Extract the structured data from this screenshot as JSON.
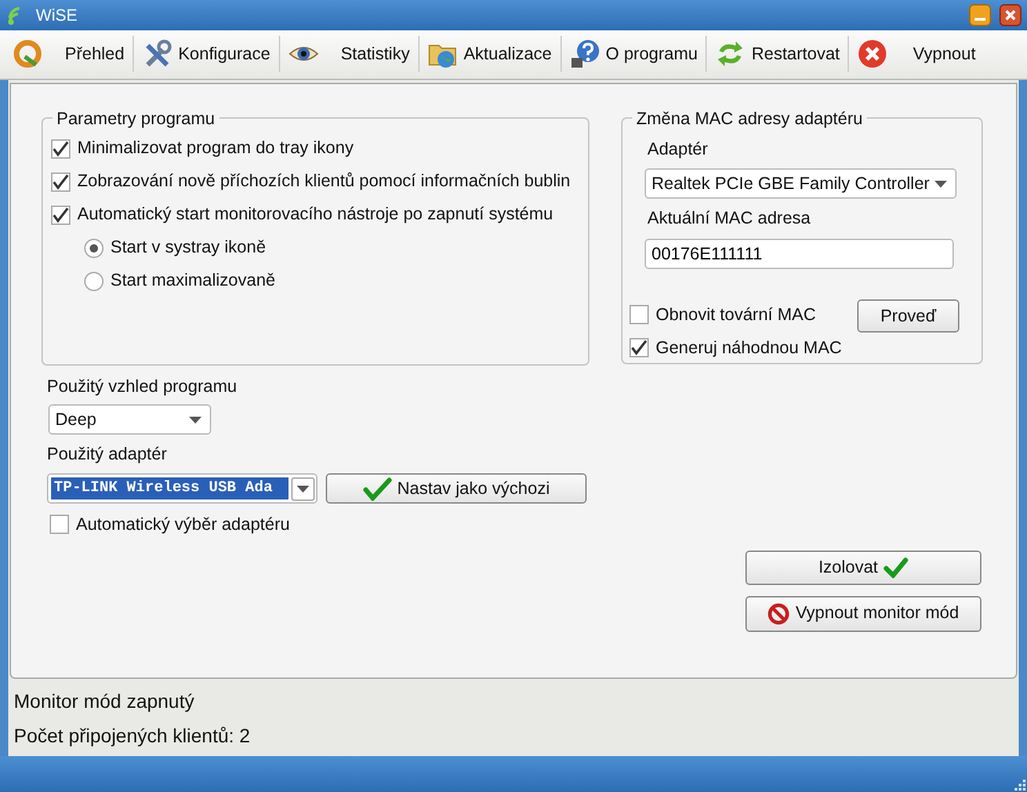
{
  "window": {
    "title": "WiSE"
  },
  "toolbar": [
    {
      "label": "Přehled"
    },
    {
      "label": "Konfigurace"
    },
    {
      "label": "Statistiky"
    },
    {
      "label": "Aktualizace"
    },
    {
      "label": "O programu"
    },
    {
      "label": "Restartovat"
    },
    {
      "label": "Vypnout"
    }
  ],
  "program_settings": {
    "title": "Parametry programu",
    "options": [
      {
        "kind": "checkbox",
        "label": "Minimalizovat program do tray ikony",
        "checked": true
      },
      {
        "kind": "checkbox",
        "label": "Zobrazování nově příchozích klientů pomocí informačních bublin",
        "checked": true
      },
      {
        "kind": "checkbox",
        "label": "Automatický start monitorovacího nástroje po zapnutí systému",
        "checked": true
      },
      {
        "kind": "radio",
        "label": "Start v systray ikoně",
        "selected": true
      },
      {
        "kind": "radio",
        "label": "Start maximalizovaně",
        "selected": false
      }
    ]
  },
  "mac_change": {
    "title": "Změna MAC adresy adaptéru",
    "adapter_label": "Adaptér",
    "adapter_value": "Realtek PCIe GBE Family Controller",
    "mac_label": "Aktuální MAC adresa",
    "mac_value": "00176E111111",
    "options": [
      {
        "label": "Obnovit tovární MAC",
        "checked": false
      },
      {
        "label": "Generuj náhodnou MAC",
        "checked": true
      }
    ],
    "apply_button": "Proveď"
  },
  "appearance": {
    "label": "Použitý vzhled programu",
    "value": "Deep"
  },
  "adapter": {
    "label": "Použitý adaptér",
    "value": "TP-LINK Wireless USB Ada",
    "text_selected": true,
    "set_default_button": "Nastav jako výchozi",
    "auto_select": {
      "label": "Automatický výběr adaptéru",
      "checked": false
    }
  },
  "isolate_button": "Izolovat",
  "monitor_off_button": "Vypnout monitor mód",
  "status_bar": [
    "Monitor mód zapnutý",
    "Počet připojených klientů: 2"
  ]
}
